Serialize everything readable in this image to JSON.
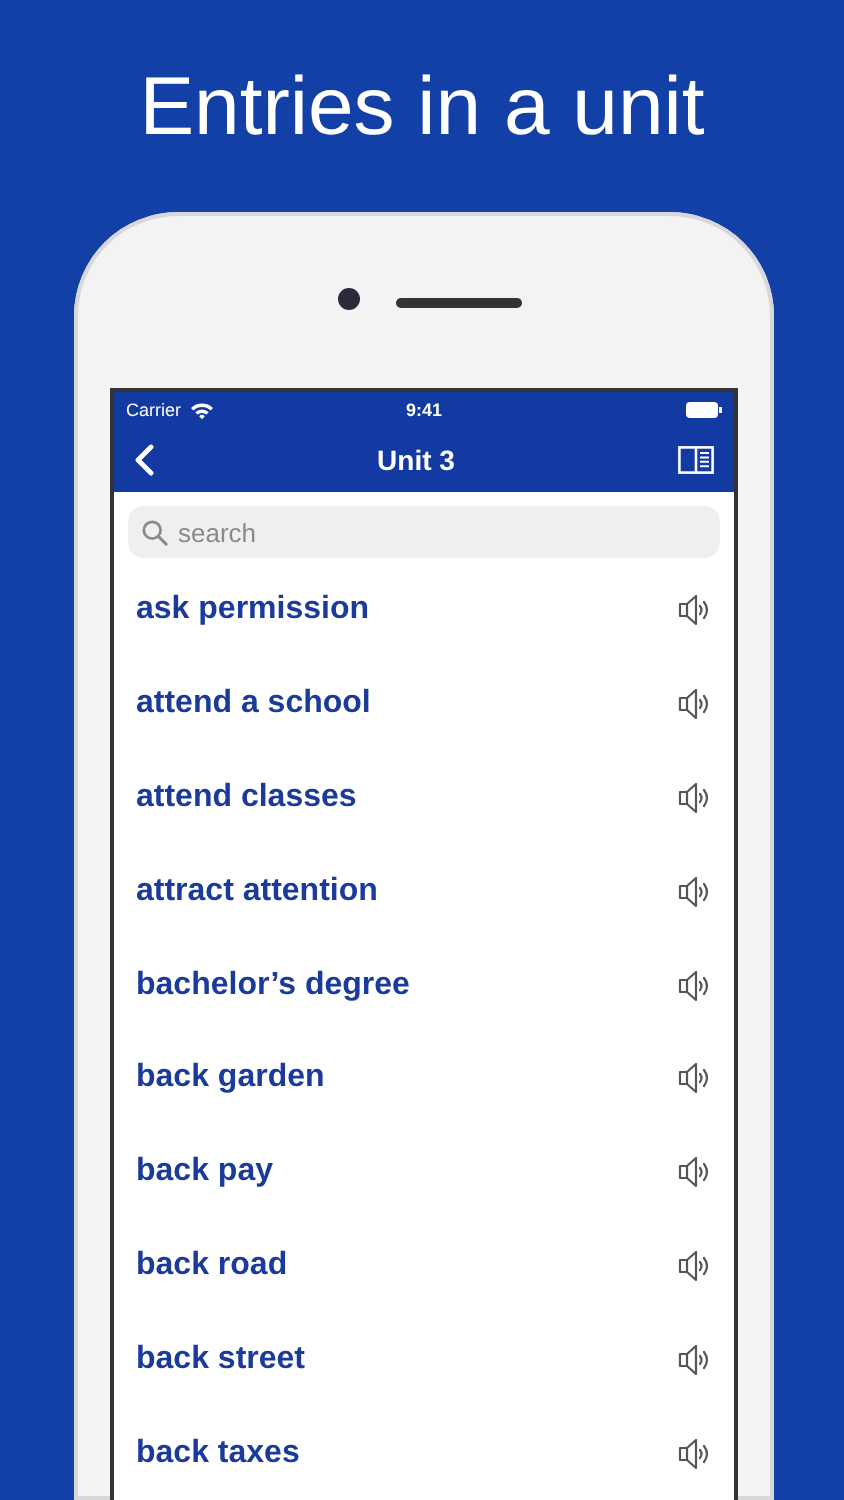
{
  "headline": "Entries in a unit",
  "status_bar": {
    "carrier": "Carrier",
    "time": "9:41"
  },
  "nav_bar": {
    "title": "Unit 3"
  },
  "search": {
    "placeholder": "search"
  },
  "entries": [
    {
      "text": "ask permission"
    },
    {
      "text": "attend a school"
    },
    {
      "text": "attend classes"
    },
    {
      "text": "attract attention"
    },
    {
      "text": "bachelor’s degree"
    },
    {
      "text": "back garden"
    },
    {
      "text": "back pay"
    },
    {
      "text": "back road"
    },
    {
      "text": "back street"
    },
    {
      "text": "back taxes"
    }
  ]
}
